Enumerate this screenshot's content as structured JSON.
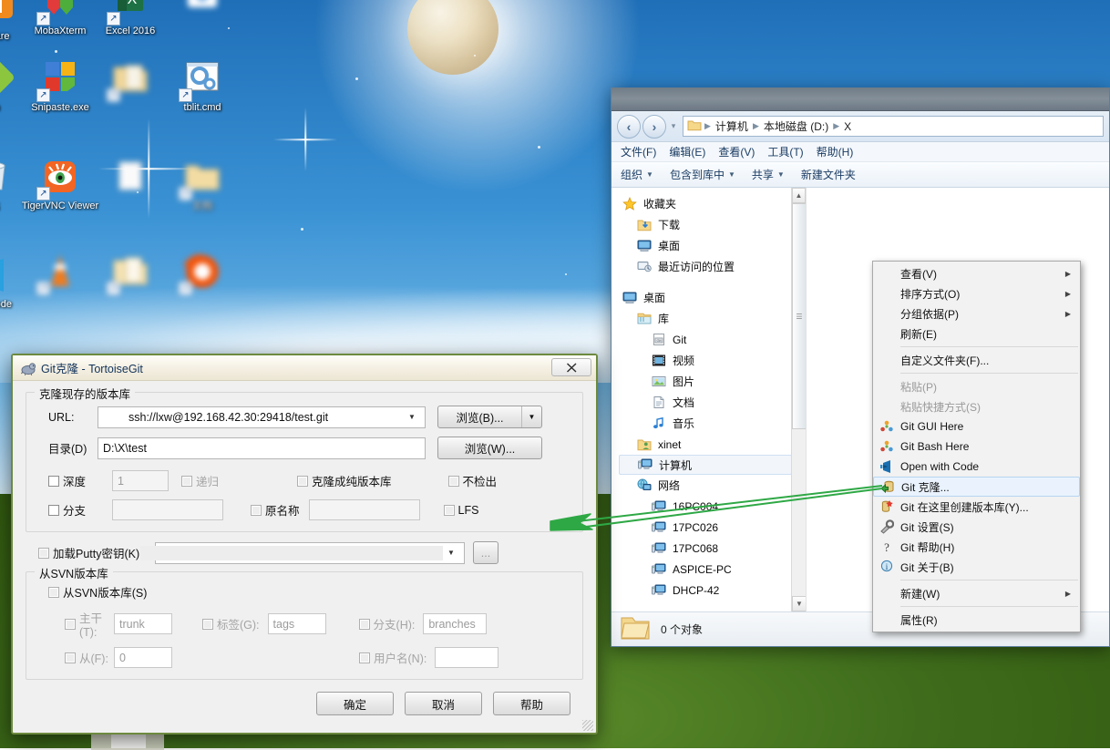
{
  "desktop": {
    "icons": [
      {
        "id": "vmware",
        "label": "e\nare",
        "blur": false,
        "partial": true
      },
      {
        "id": "mobaxterm",
        "label": "MobaXterm",
        "blur": false
      },
      {
        "id": "excel2016",
        "label": "Excel 2016",
        "blur": false
      },
      {
        "id": "unknown-top",
        "label": "",
        "blur": true
      },
      {
        "id": "git-bash",
        "label": "sh",
        "blur": false,
        "partial": true
      },
      {
        "id": "snipaste",
        "label": "Snipaste.exe",
        "blur": false
      },
      {
        "id": "folder-blur-1",
        "label": "",
        "blur": true
      },
      {
        "id": "tblit-cmd",
        "label": "tblit.cmd",
        "blur": false
      },
      {
        "id": "recycle-bin",
        "label": "站",
        "blur": false,
        "partial": true
      },
      {
        "id": "tigervnc",
        "label": "TigerVNC Viewer",
        "blur": false
      },
      {
        "id": "blur-doc",
        "label": "",
        "blur": true
      },
      {
        "id": "blur-folder-2",
        "label": "文档",
        "blur": true
      },
      {
        "id": "vscode",
        "label": "al\nCode",
        "blur": false,
        "partial": true
      },
      {
        "id": "vlc",
        "label": "",
        "blur": true
      },
      {
        "id": "folder-blur-3",
        "label": "",
        "blur": true
      },
      {
        "id": "firefox-blur",
        "label": "",
        "blur": true
      }
    ]
  },
  "explorer": {
    "nav": {
      "back_icon": "back-arrow-icon",
      "forward_icon": "forward-arrow-icon",
      "recent_icon": "chevron-down-icon",
      "breadcrumbs": [
        "计算机",
        "本地磁盘 (D:)",
        "X"
      ]
    },
    "menubar": [
      "文件(F)",
      "编辑(E)",
      "查看(V)",
      "工具(T)",
      "帮助(H)"
    ],
    "toolbar": [
      {
        "label": "组织",
        "caret": true
      },
      {
        "label": "包含到库中",
        "caret": true
      },
      {
        "label": "共享",
        "caret": true
      },
      {
        "label": "新建文件夹",
        "caret": false
      }
    ],
    "tree": [
      {
        "label": "收藏夹",
        "indent": 0,
        "icon": "star-icon",
        "sel": false
      },
      {
        "label": "下载",
        "indent": 1,
        "icon": "downloads-icon",
        "sel": false
      },
      {
        "label": "桌面",
        "indent": 1,
        "icon": "desktop-icon",
        "sel": false
      },
      {
        "label": "最近访问的位置",
        "indent": 1,
        "icon": "recent-icon",
        "sel": false
      },
      {
        "label": "__GAP__",
        "indent": 0,
        "icon": "",
        "sel": false
      },
      {
        "label": "桌面",
        "indent": 0,
        "icon": "desktop-icon",
        "sel": false
      },
      {
        "label": "库",
        "indent": 1,
        "icon": "library-icon",
        "sel": false
      },
      {
        "label": "Git",
        "indent": 2,
        "icon": "git-folder-icon",
        "sel": false
      },
      {
        "label": "视频",
        "indent": 2,
        "icon": "video-icon",
        "sel": false
      },
      {
        "label": "图片",
        "indent": 2,
        "icon": "picture-icon",
        "sel": false
      },
      {
        "label": "文档",
        "indent": 2,
        "icon": "document-icon",
        "sel": false
      },
      {
        "label": "音乐",
        "indent": 2,
        "icon": "music-icon",
        "sel": false
      },
      {
        "label": "xinet",
        "indent": 1,
        "icon": "user-folder-icon",
        "sel": false
      },
      {
        "label": "计算机",
        "indent": 1,
        "icon": "computer-icon",
        "sel": true
      },
      {
        "label": "网络",
        "indent": 1,
        "icon": "network-icon",
        "sel": false
      },
      {
        "label": "16PC004",
        "indent": 2,
        "icon": "computer-icon",
        "sel": false
      },
      {
        "label": "17PC026",
        "indent": 2,
        "icon": "computer-icon",
        "sel": false
      },
      {
        "label": "17PC068",
        "indent": 2,
        "icon": "computer-icon",
        "sel": false
      },
      {
        "label": "ASPICE-PC",
        "indent": 2,
        "icon": "computer-icon",
        "sel": false
      },
      {
        "label": "DHCP-42",
        "indent": 2,
        "icon": "computer-icon",
        "sel": false
      }
    ],
    "status": {
      "folder_icon": "folder-icon",
      "text": "0 个对象"
    }
  },
  "context_menu": {
    "items": [
      {
        "label": "查看(V)",
        "icon": "",
        "submenu": true,
        "disabled": false,
        "highlight": false
      },
      {
        "label": "排序方式(O)",
        "icon": "",
        "submenu": true,
        "disabled": false,
        "highlight": false
      },
      {
        "label": "分组依据(P)",
        "icon": "",
        "submenu": true,
        "disabled": false,
        "highlight": false
      },
      {
        "label": "刷新(E)",
        "icon": "",
        "submenu": false,
        "disabled": false,
        "highlight": false
      },
      {
        "sep": true
      },
      {
        "label": "自定义文件夹(F)...",
        "icon": "",
        "submenu": false,
        "disabled": false,
        "highlight": false
      },
      {
        "sep": true
      },
      {
        "label": "粘贴(P)",
        "icon": "",
        "submenu": false,
        "disabled": true,
        "highlight": false
      },
      {
        "label": "粘贴快捷方式(S)",
        "icon": "",
        "submenu": false,
        "disabled": true,
        "highlight": false
      },
      {
        "label": "Git GUI Here",
        "icon": "git-logo-icon",
        "submenu": false,
        "disabled": false,
        "highlight": false
      },
      {
        "label": "Git Bash Here",
        "icon": "git-logo-icon",
        "submenu": false,
        "disabled": false,
        "highlight": false
      },
      {
        "label": "Open with Code",
        "icon": "vscode-icon",
        "submenu": false,
        "disabled": false,
        "highlight": false
      },
      {
        "label": "Git 克隆...",
        "icon": "git-clone-icon",
        "submenu": false,
        "disabled": false,
        "highlight": true
      },
      {
        "label": "Git 在这里创建版本库(Y)...",
        "icon": "git-create-icon",
        "submenu": false,
        "disabled": false,
        "highlight": false
      },
      {
        "label": "Git 设置(S)",
        "icon": "git-settings-icon",
        "submenu": false,
        "disabled": false,
        "highlight": false
      },
      {
        "label": "Git 帮助(H)",
        "icon": "git-help-icon",
        "submenu": false,
        "disabled": false,
        "highlight": false
      },
      {
        "label": "Git 关于(B)",
        "icon": "git-about-icon",
        "submenu": false,
        "disabled": false,
        "highlight": false
      },
      {
        "sep": true
      },
      {
        "label": "新建(W)",
        "icon": "",
        "submenu": true,
        "disabled": false,
        "highlight": false
      },
      {
        "sep": true
      },
      {
        "label": "属性(R)",
        "icon": "",
        "submenu": false,
        "disabled": false,
        "highlight": false
      }
    ]
  },
  "dialog": {
    "title": "Git克隆 - TortoiseGit",
    "icon": "tortoisegit-icon",
    "close_label": "✕",
    "clone_group": {
      "legend": "克隆现存的版本库",
      "url_label": "URL:",
      "url_value": "ssh://lxw@192.168.42.30:29418/test.git",
      "url_browse": "浏览(B)...",
      "dir_label": "目录(D)",
      "dir_value": "D:\\X\\test",
      "dir_browse": "浏览(W)...",
      "depth_label": "深度",
      "depth_checked": false,
      "depth_value": "1",
      "recursive_label": "递归",
      "recursive_checked": false,
      "bare_label": "克隆成纯版本库",
      "bare_checked": false,
      "nocheckout_label": "不检出",
      "nocheckout_checked": false,
      "branch_label": "分支",
      "branch_checked": false,
      "branch_value": "",
      "origin_label": "原名称",
      "origin_checked": false,
      "origin_value": "",
      "lfs_label": "LFS",
      "lfs_checked": false
    },
    "putty": {
      "label": "加载Putty密钥(K)",
      "checked": false,
      "value": "",
      "browse_label": "..."
    },
    "svn_group": {
      "legend": "从SVN版本库",
      "enable_label": "从SVN版本库(S)",
      "enable_checked": false,
      "trunk_label": "主干(T):",
      "trunk_value": "trunk",
      "tags_label": "标签(G):",
      "tags_value": "tags",
      "branch_label": "分支(H):",
      "branch_value": "branches",
      "from_label": "从(F):",
      "from_value": "0",
      "username_label": "用户名(N):",
      "username_value": ""
    },
    "buttons": {
      "ok": "确定",
      "cancel": "取消",
      "help": "帮助"
    }
  },
  "annotation": {
    "type": "arrow",
    "color": "#2ea845",
    "description": "green arrow from Git 克隆 menu item to the TortoiseGit dialog"
  }
}
